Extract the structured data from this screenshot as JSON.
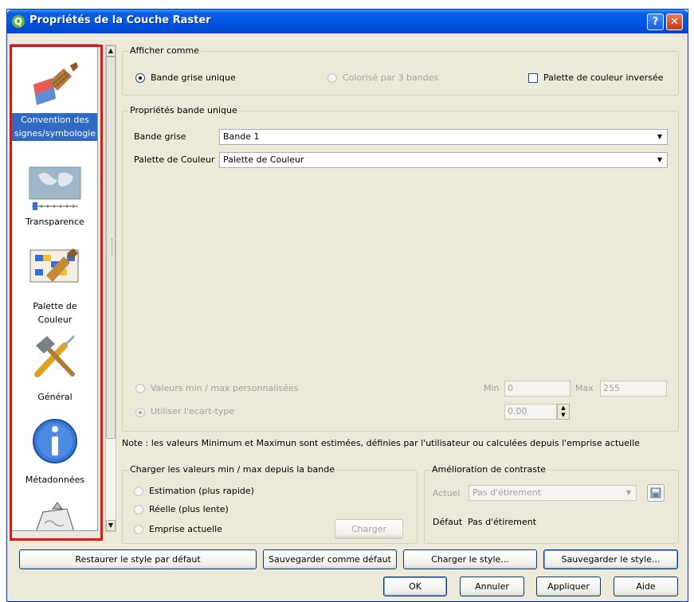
{
  "window": {
    "title": "Propriétés de la Couche Raster",
    "help_label": "?",
    "close_label": "✕"
  },
  "sidebar": {
    "items": [
      {
        "label_line1": "Convention des",
        "label_line2": "signes/symbologie",
        "icon": "paintbrush-icon"
      },
      {
        "label_line1": "Transparence",
        "label_line2": "",
        "icon": "world-map-slider-icon"
      },
      {
        "label_line1": "Palette de",
        "label_line2": "Couleur",
        "icon": "grid-brush-icon"
      },
      {
        "label_line1": "Général",
        "label_line2": "",
        "icon": "hammer-screwdriver-icon"
      },
      {
        "label_line1": "Métadonnées",
        "label_line2": "",
        "icon": "info-icon"
      }
    ]
  },
  "afficher": {
    "title": "Afficher comme",
    "bande_grise": "Bande grise unique",
    "colorise": "Colorisé par 3 bandes",
    "palette_inversee": "Palette de couleur inversée"
  },
  "bande_unique": {
    "title": "Propriétés bande unique",
    "bande_grise_label": "Bande grise",
    "bande_grise_value": "Bande 1",
    "palette_label": "Palette de Couleur",
    "palette_value": "Palette de Couleur",
    "valeurs_perso": "Valeurs min / max personnalisées",
    "min_label": "Min",
    "min_value": "0",
    "max_label": "Max",
    "max_value": "255",
    "ecart_type": "Utiliser l'ecart-type",
    "ecart_value": "0.00"
  },
  "note": "Note : les valeurs Minimum et Maximun sont estimées, définies par l'utilisateur ou calculées depuis l'emprise actuelle",
  "charger": {
    "title": "Charger les valeurs min / max depuis la bande",
    "estimation": "Estimation (plus rapide)",
    "reelle": "Réelle (plus lente)",
    "emprise": "Emprise actuelle",
    "button": "Charger"
  },
  "contraste": {
    "title": "Amélioration de contraste",
    "actuel_label": "Actuel",
    "actuel_value": "Pas d'étirement",
    "defaut_label": "Défaut",
    "defaut_value": "Pas d'étirement"
  },
  "style_buttons": {
    "restaurer": "Restaurer le style par défaut",
    "sauvegarder_defaut": "Sauvegarder comme défaut",
    "charger_style": "Charger le style...",
    "sauvegarder_style": "Sauvegarder le style..."
  },
  "dialog_buttons": {
    "ok": "OK",
    "annuler": "Annuler",
    "appliquer": "Appliquer",
    "aide": "Aide"
  }
}
